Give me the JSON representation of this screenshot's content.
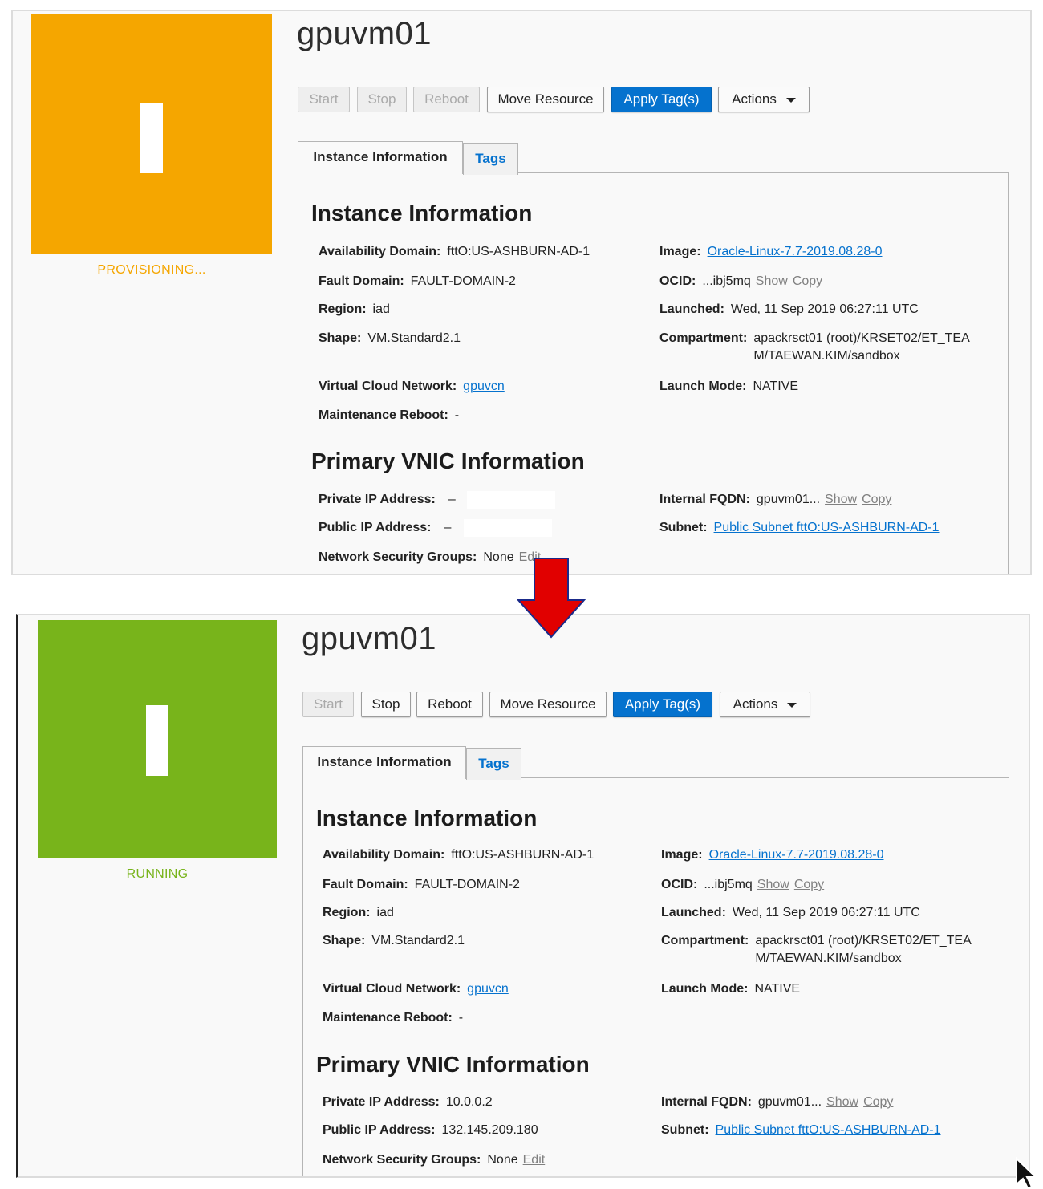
{
  "colors": {
    "provisioning": "#f5a600",
    "running": "#78b41b",
    "primary_button": "#0572ce",
    "arrow": "#e10000"
  },
  "before": {
    "status_label": "PROVISIONING...",
    "instance_name": "gpuvm01",
    "buttons": {
      "start": "Start",
      "stop": "Stop",
      "reboot": "Reboot",
      "move_resource": "Move Resource",
      "apply_tags": "Apply Tag(s)",
      "actions": "Actions"
    },
    "tabs": {
      "instance_information": "Instance Information",
      "tags": "Tags"
    },
    "instance_info": {
      "title": "Instance Information",
      "availability_domain_label": "Availability Domain:",
      "availability_domain": "fttO:US-ASHBURN-AD-1",
      "fault_domain_label": "Fault Domain:",
      "fault_domain": "FAULT-DOMAIN-2",
      "region_label": "Region:",
      "region": "iad",
      "shape_label": "Shape:",
      "shape": "VM.Standard2.1",
      "vcn_label": "Virtual Cloud Network:",
      "vcn": "gpuvcn",
      "maintenance_label": "Maintenance Reboot:",
      "maintenance": "-",
      "image_label": "Image:",
      "image": "Oracle-Linux-7.7-2019.08.28-0",
      "ocid_label": "OCID:",
      "ocid": "...ibj5mq",
      "show": "Show",
      "copy": "Copy",
      "launched_label": "Launched:",
      "launched": "Wed, 11 Sep 2019 06:27:11 UTC",
      "compartment_label": "Compartment:",
      "compartment": "apackrsct01 (root)/KRSET02/ET_TEAM/TAEWAN.KIM/sandbox",
      "launch_mode_label": "Launch Mode:",
      "launch_mode": "NATIVE"
    },
    "vnic_info": {
      "title": "Primary VNIC Information",
      "private_ip_label": "Private IP Address:",
      "private_ip": "–",
      "public_ip_label": "Public IP Address:",
      "public_ip": "–",
      "nsg_label": "Network Security Groups:",
      "nsg": "None",
      "edit": "Edit",
      "fqdn_label": "Internal FQDN:",
      "fqdn": "gpuvm01...",
      "show": "Show",
      "copy": "Copy",
      "subnet_label": "Subnet:",
      "subnet": "Public Subnet fttO:US-ASHBURN-AD-1"
    }
  },
  "after": {
    "status_label": "RUNNING",
    "instance_name": "gpuvm01",
    "buttons": {
      "start": "Start",
      "stop": "Stop",
      "reboot": "Reboot",
      "move_resource": "Move Resource",
      "apply_tags": "Apply Tag(s)",
      "actions": "Actions"
    },
    "tabs": {
      "instance_information": "Instance Information",
      "tags": "Tags"
    },
    "instance_info": {
      "title": "Instance Information",
      "availability_domain_label": "Availability Domain:",
      "availability_domain": "fttO:US-ASHBURN-AD-1",
      "fault_domain_label": "Fault Domain:",
      "fault_domain": "FAULT-DOMAIN-2",
      "region_label": "Region:",
      "region": "iad",
      "shape_label": "Shape:",
      "shape": "VM.Standard2.1",
      "vcn_label": "Virtual Cloud Network:",
      "vcn": "gpuvcn",
      "maintenance_label": "Maintenance Reboot:",
      "maintenance": "-",
      "image_label": "Image:",
      "image": "Oracle-Linux-7.7-2019.08.28-0",
      "ocid_label": "OCID:",
      "ocid": "...ibj5mq",
      "show": "Show",
      "copy": "Copy",
      "launched_label": "Launched:",
      "launched": "Wed, 11 Sep 2019 06:27:11 UTC",
      "compartment_label": "Compartment:",
      "compartment": "apackrsct01 (root)/KRSET02/ET_TEAM/TAEWAN.KIM/sandbox",
      "launch_mode_label": "Launch Mode:",
      "launch_mode": "NATIVE"
    },
    "vnic_info": {
      "title": "Primary VNIC Information",
      "private_ip_label": "Private IP Address:",
      "private_ip": "10.0.0.2",
      "public_ip_label": "Public IP Address:",
      "public_ip": "132.145.209.180",
      "nsg_label": "Network Security Groups:",
      "nsg": "None",
      "edit": "Edit",
      "fqdn_label": "Internal FQDN:",
      "fqdn": "gpuvm01...",
      "show": "Show",
      "copy": "Copy",
      "subnet_label": "Subnet:",
      "subnet": "Public Subnet fttO:US-ASHBURN-AD-1"
    }
  }
}
